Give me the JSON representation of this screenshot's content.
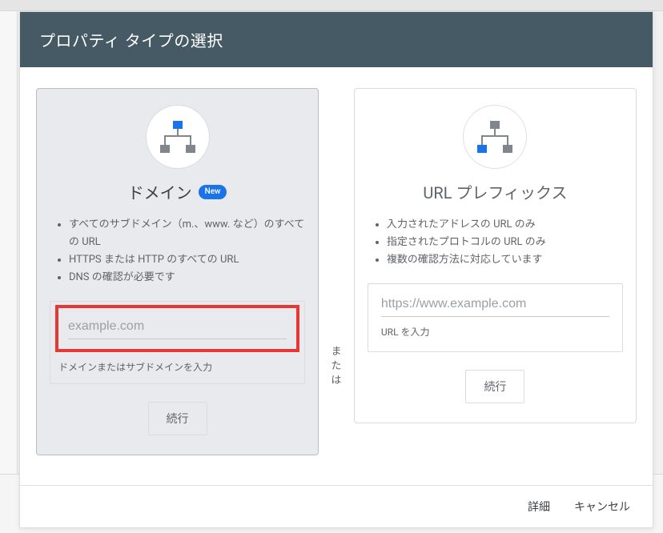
{
  "modal": {
    "title": "プロパティ タイプの選択",
    "footer": {
      "details": "詳細",
      "cancel": "キャンセル"
    }
  },
  "divider": "または",
  "domain_card": {
    "title": "ドメイン",
    "badge": "New",
    "features": [
      "すべてのサブドメイン（m.、www. など）のすべての URL",
      "HTTPS または HTTP のすべての URL",
      "DNS の確認が必要です"
    ],
    "input_placeholder": "example.com",
    "input_helper": "ドメインまたはサブドメインを入力",
    "continue": "続行"
  },
  "prefix_card": {
    "title": "URL プレフィックス",
    "features": [
      "入力されたアドレスの URL のみ",
      "指定されたプロトコルの URL のみ",
      "複数の確認方法に対応しています"
    ],
    "input_placeholder": "https://www.example.com",
    "input_helper": "URL を入力",
    "continue": "続行"
  }
}
